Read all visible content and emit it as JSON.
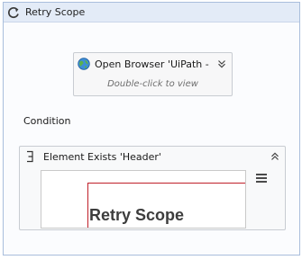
{
  "retry_scope": {
    "title": "Retry Scope",
    "icon": "refresh-icon",
    "open_browser": {
      "title": "Open Browser 'UiPath - Ret",
      "icon": "globe-icon",
      "chevron": "chevron-double-down-icon",
      "hint": "Double-click to view"
    },
    "condition_label": "Condition",
    "element_exists": {
      "title": "Element Exists 'Header'",
      "icon": "element-exists-icon",
      "collapse": "chevron-double-up-icon",
      "menu": "hamburger-menu-icon",
      "preview_text": "Retry Scope"
    }
  },
  "colors": {
    "accent_border": "#a9bedc",
    "header_bg": "#e3ebf7",
    "selection_red": "#c0202a"
  }
}
